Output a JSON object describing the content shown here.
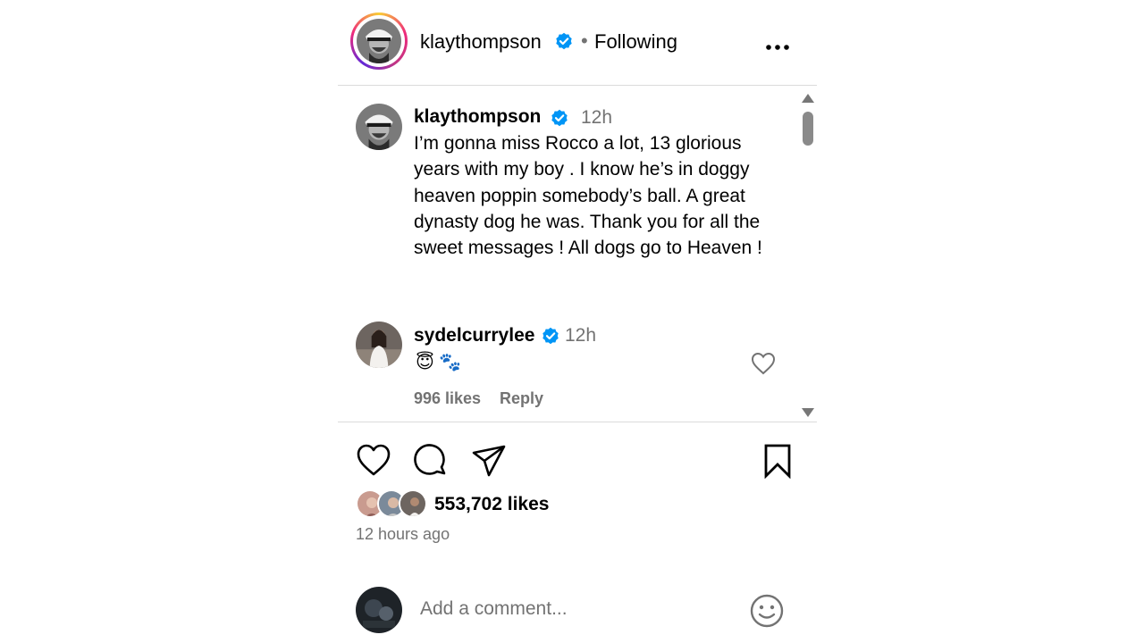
{
  "post": {
    "author": "klaythompson",
    "following_label": "Following",
    "separator": "•"
  },
  "caption": {
    "username": "klaythompson",
    "time": "12h",
    "text": "I’m gonna miss Rocco a lot, 13 glorious years with my boy . I know he’s in doggy heaven poppin somebody’s ball. A great dynasty dog he was. Thank you for all the sweet messages ! All dogs go to Heaven !"
  },
  "comment": {
    "username": "sydelcurrylee",
    "time": "12h",
    "text": "😇 🐾",
    "likes": "996 likes",
    "reply_label": "Reply"
  },
  "engagement": {
    "likes": "553,702 likes",
    "posted_ago": "12 hours ago"
  },
  "add_comment": {
    "placeholder": "Add a comment..."
  },
  "icons": {
    "verified": "verified-badge-icon",
    "more": "more-options-icon",
    "like": "heart-icon",
    "comment": "comment-icon",
    "share": "paper-plane-icon",
    "save": "bookmark-icon",
    "emoji": "smiley-icon"
  },
  "colors": {
    "verified_blue": "#0095f6",
    "muted_text": "#737373",
    "divider": "#dbdbdb"
  }
}
